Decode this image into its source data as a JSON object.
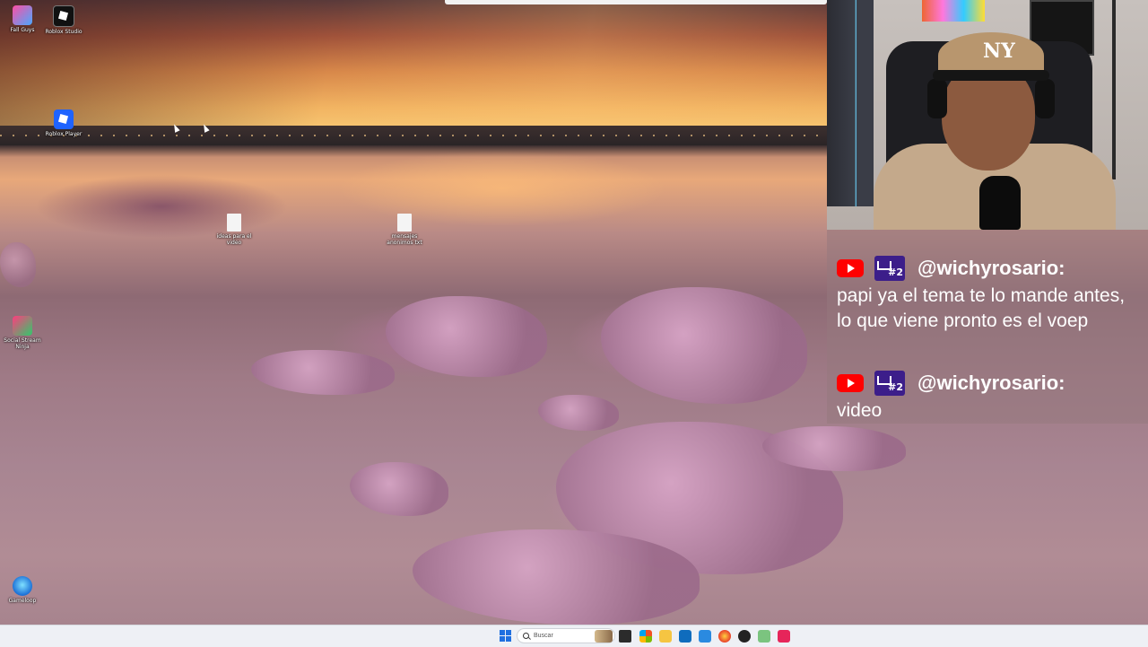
{
  "desktop": {
    "icons": [
      {
        "label": "Fall Guys",
        "icon": "fall-guys-icon"
      },
      {
        "label": "Roblox Studio",
        "icon": "roblox-studio-icon"
      },
      {
        "label": "Roblox Player",
        "icon": "roblox-player-icon"
      },
      {
        "label": "ideas para el video",
        "icon": "document-icon"
      },
      {
        "label": "mensajes anonimos txt",
        "icon": "document-icon"
      },
      {
        "label": "Social Stream Ninja",
        "icon": "social-stream-ninja-icon"
      },
      {
        "label": "Gameloop",
        "icon": "gameloop-icon"
      }
    ]
  },
  "chat": {
    "messages": [
      {
        "platform": "youtube-icon",
        "badge": "#2",
        "user": "@wichyrosario:",
        "text": "papi ya el tema te lo mande antes, lo que viene pronto es el voep"
      },
      {
        "platform": "youtube-icon",
        "badge": "#2",
        "user": "@wichyrosario:",
        "text": "video"
      }
    ]
  },
  "taskbar": {
    "search_placeholder": "Buscar",
    "apps": [
      "task-view-icon",
      "file-explorer-icon",
      "edge-icon",
      "folder-icon",
      "store-icon",
      "mail-icon",
      "firefox-icon",
      "obs-icon",
      "xbox-icon",
      "tiktok-icon"
    ]
  },
  "colors": {
    "chat_user": "#ffffff",
    "youtube_red": "#ff0000",
    "badge_purple": "#3c1e8a",
    "taskbar_bg": "#eef0f5"
  }
}
